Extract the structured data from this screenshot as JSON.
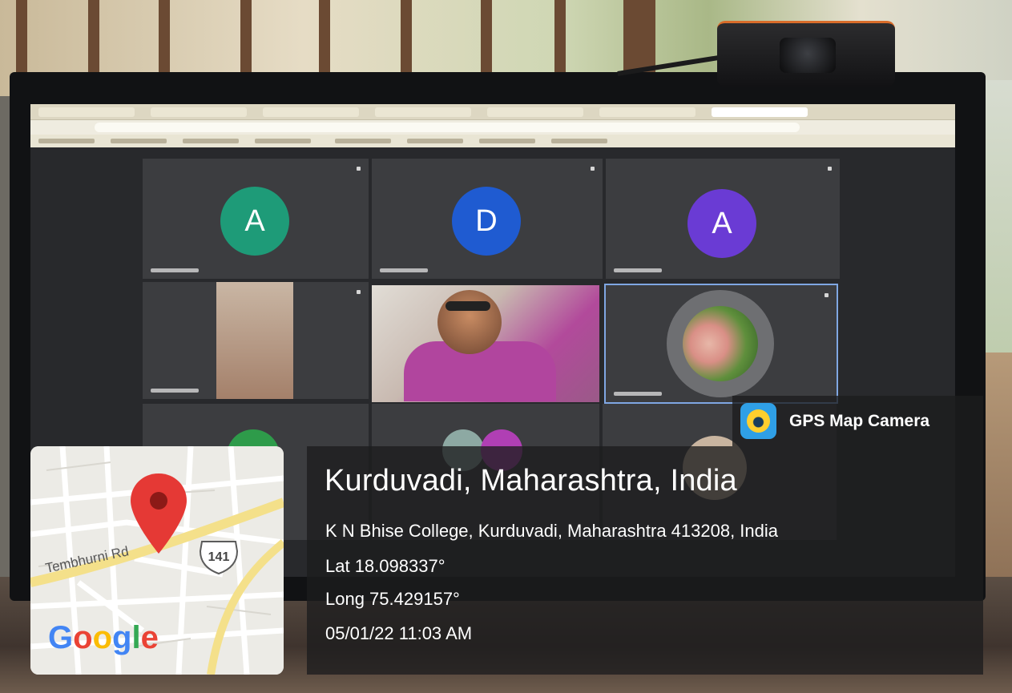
{
  "scene": {
    "description_icons": [
      "webcam-icon",
      "monitor-icon"
    ],
    "video_call_tiles": [
      {
        "initial": "A",
        "color": "#1e9b78"
      },
      {
        "initial": "D",
        "color": "#1f5bd1"
      },
      {
        "initial": "A",
        "color": "#6a3bd4"
      }
    ]
  },
  "map": {
    "road_label": "Tembhurni Rd",
    "highway_shield": "141",
    "logo": "Google"
  },
  "badge": {
    "label": "GPS Map Camera"
  },
  "location": {
    "title": "Kurduvadi, Maharashtra, India",
    "address": "K N Bhise College, Kurduvadi, Maharashtra 413208, India",
    "lat": "Lat 18.098337°",
    "long": "Long 75.429157°",
    "datetime": "05/01/22 11:03 AM"
  },
  "colors": {
    "panel_bg": "#1c1c1e",
    "pin_red": "#e53935",
    "road_yellow": "#f4e08a"
  }
}
